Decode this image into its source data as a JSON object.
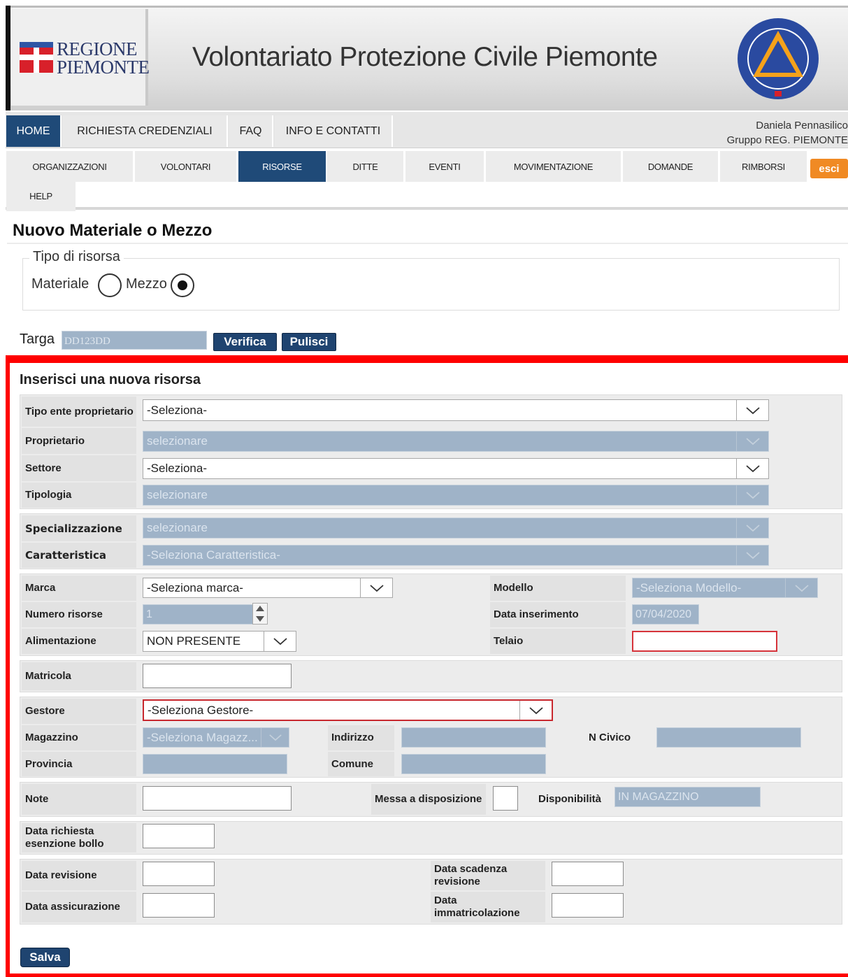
{
  "header": {
    "logo_line1": "REGIONE",
    "logo_line2": "PIEMONTE",
    "title": "Volontariato Protezione Civile Piemonte",
    "emblem_icon": "protezione-civile-emblem-icon"
  },
  "topnav": {
    "items": [
      "HOME",
      "RICHIESTA CREDENZIALI",
      "FAQ",
      "INFO E CONTATTI"
    ],
    "active": "HOME",
    "user_name": "Daniela Pennasilico",
    "user_group": "Gruppo REG. PIEMONTE"
  },
  "subnav": {
    "items": [
      "ORGANIZZAZIONI",
      "VOLONTARI",
      "RISORSE",
      "DITTE",
      "EVENTI",
      "MOVIMENTAZIONE",
      "DOMANDE",
      "RIMBORSI",
      "HELP"
    ],
    "active": "RISORSE",
    "logout_label": "esci"
  },
  "page": {
    "title": "Nuovo Materiale o Mezzo",
    "resource_type": {
      "legend": "Tipo di risorsa",
      "options": [
        "Materiale",
        "Mezzo"
      ],
      "selected": "Mezzo"
    },
    "targa": {
      "label": "Targa",
      "value": "DD123DD",
      "verify_label": "Verifica",
      "clear_label": "Pulisci"
    }
  },
  "form": {
    "title": "Inserisci una nuova risorsa",
    "tipo_ente": {
      "label": "Tipo ente proprietario",
      "value": "-Seleziona-"
    },
    "proprietario": {
      "label": "Proprietario",
      "value": "selezionare"
    },
    "settore": {
      "label": "Settore",
      "value": "-Seleziona-"
    },
    "tipologia": {
      "label": "Tipologia",
      "value": "selezionare"
    },
    "specializzazione": {
      "label": "Specializzazione",
      "value": "selezionare"
    },
    "caratteristica": {
      "label": "Caratteristica",
      "value": "-Seleziona Caratteristica-"
    },
    "marca": {
      "label": "Marca",
      "value": "-Seleziona marca-"
    },
    "modello": {
      "label": "Modello",
      "value": "-Seleziona Modello-"
    },
    "numero_risorse": {
      "label": "Numero risorse",
      "value": "1"
    },
    "data_inserimento": {
      "label": "Data inserimento",
      "value": "07/04/2020"
    },
    "alimentazione": {
      "label": "Alimentazione",
      "value": "NON PRESENTE"
    },
    "telaio": {
      "label": "Telaio",
      "value": ""
    },
    "matricola": {
      "label": "Matricola",
      "value": ""
    },
    "gestore": {
      "label": "Gestore",
      "value": "-Seleziona Gestore-"
    },
    "magazzino": {
      "label": "Magazzino",
      "value": "-Seleziona Magazz..."
    },
    "indirizzo": {
      "label": "Indirizzo",
      "value": ""
    },
    "n_civico": {
      "label": "N Civico",
      "value": ""
    },
    "provincia": {
      "label": "Provincia",
      "value": ""
    },
    "comune": {
      "label": "Comune",
      "value": ""
    },
    "note": {
      "label": "Note",
      "value": ""
    },
    "messa_disposizione": {
      "label": "Messa a disposizione",
      "checked": false
    },
    "disponibilita": {
      "label": "Disponibilità",
      "value": "IN MAGAZZINO"
    },
    "data_esenzione_bollo": {
      "label": "Data richiesta esenzione bollo",
      "value": ""
    },
    "data_revisione": {
      "label": "Data revisione",
      "value": ""
    },
    "data_scadenza_revisione": {
      "label": "Data scadenza revisione",
      "value": ""
    },
    "data_assicurazione": {
      "label": "Data assicurazione",
      "value": ""
    },
    "data_immatricolazione": {
      "label": "Data immatricolazione",
      "value": ""
    },
    "save_label": "Salva"
  },
  "colors": {
    "nav_active": "#1f4a78",
    "highlight_frame": "#ff0000",
    "logout": "#f08a24",
    "disabled_field": "#9fb3c8"
  }
}
